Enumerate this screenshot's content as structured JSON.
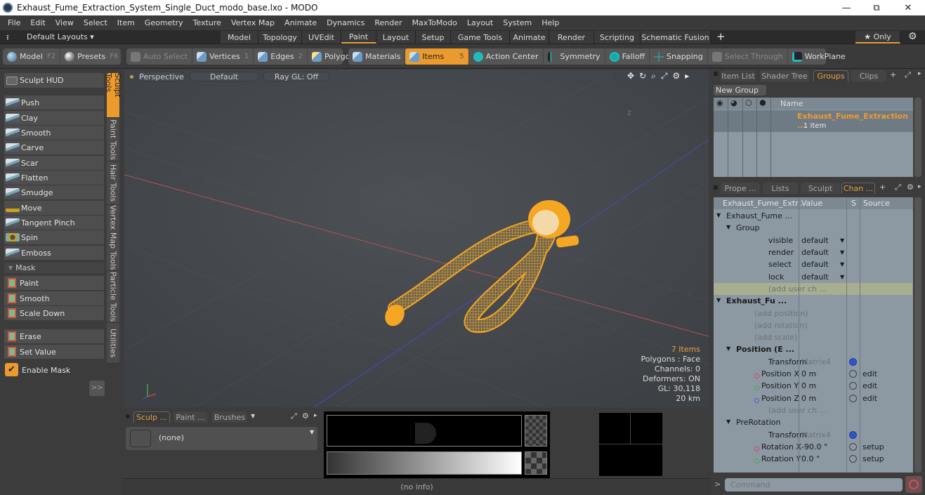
{
  "window": {
    "title": "Exhaust_Fume_Extraction_System_Single_Duct_modo_base.lxo - MODO",
    "minimize": "—",
    "restore": "⧉",
    "close": "✕"
  },
  "menu": [
    "File",
    "Edit",
    "View",
    "Select",
    "Item",
    "Geometry",
    "Texture",
    "Vertex Map",
    "Animate",
    "Dynamics",
    "Render",
    "MaxToModo",
    "Layout",
    "System",
    "Help"
  ],
  "layouts": {
    "dropdown": "Default Layouts ▾",
    "tabs": [
      "Model",
      "Topology",
      "UVEdit",
      "Paint",
      "Layout",
      "Setup",
      "Game Tools",
      "Animate",
      "Render",
      "Scripting",
      "Schematic Fusion"
    ],
    "active_tab": "Paint",
    "add": "+",
    "only": "★ Only"
  },
  "toolbar": {
    "model": "Model",
    "model_key": "F2",
    "presets": "Presets",
    "presets_key": "F6",
    "auto_select": "Auto Select",
    "vertices": "Vertices",
    "vertices_key": "1",
    "edges": "Edges",
    "edges_key": "2",
    "polygons": "Polygons",
    "materials": "Materials",
    "items": "Items",
    "items_key": "5",
    "action_center": "Action Center",
    "symmetry": "Symmetry",
    "falloff": "Falloff",
    "snapping": "Snapping",
    "select_through": "Select Through",
    "workplane": "WorkPlane"
  },
  "left": {
    "sculpt_hud": "Sculpt HUD",
    "tools": [
      "Push",
      "Clay",
      "Smooth",
      "Carve",
      "Scar",
      "Flatten",
      "Smudge",
      "Move",
      "Tangent Pinch",
      "Spin",
      "Emboss"
    ],
    "mask_header": "Mask",
    "mask_tools": [
      "Paint",
      "Smooth",
      "Scale Down"
    ],
    "mask_tools2": [
      "Erase",
      "Set Value"
    ],
    "enable_mask": "Enable Mask",
    "enable_mask_checked": true,
    "expand": ">>",
    "vtabs": [
      "Sculpt Tools",
      "Paint Tools",
      "Hair Tools",
      "Vertex Map Tools",
      "Particle Tools",
      "Utilities"
    ]
  },
  "viewport": {
    "view": "Perspective",
    "style": "Default",
    "raygl": "Ray GL: Off",
    "axis_label": "Z",
    "stats": {
      "items": "7 Items",
      "polygons": "Polygons : Face",
      "channels": "Channels: 0",
      "deformers": "Deformers: ON",
      "gl": "GL: 30,118",
      "scale": "20 km"
    }
  },
  "groups_panel": {
    "tabs": [
      "Item List",
      "Shader Tree",
      "Groups",
      "Clips"
    ],
    "active_tab": "Groups",
    "new_group": "New Group",
    "col_name": "Name",
    "group_name": "Exhaust_Fume_Extraction ...",
    "group_count": "1 Item"
  },
  "channels_panel": {
    "tabs": [
      "Prope ...",
      "Lists",
      "Sculpt",
      "Chan ..."
    ],
    "active_tab": "Chan ...",
    "headers": [
      "Exhaust_Fume_Extr...",
      "Value",
      "S",
      "Source"
    ],
    "rows": [
      {
        "name": "Exhaust_Fume ...",
        "indent": 1,
        "type": "item"
      },
      {
        "name": "Group",
        "indent": 2,
        "type": "group"
      },
      {
        "name": "visible",
        "value": "default",
        "dropdown": true,
        "indent": 3
      },
      {
        "name": "render",
        "value": "default",
        "dropdown": true,
        "indent": 3
      },
      {
        "name": "select",
        "value": "default",
        "dropdown": true,
        "indent": 3
      },
      {
        "name": "lock",
        "value": "default",
        "dropdown": true,
        "indent": 3
      },
      {
        "name": "(add user ch ...",
        "indent": 3,
        "gray": true,
        "highlight": true
      },
      {
        "name": "Exhaust_Fu  ...",
        "indent": 1,
        "bold": true,
        "type": "locator"
      },
      {
        "name": "(add position)",
        "indent": 2,
        "gray": true
      },
      {
        "name": "(add rotation)",
        "indent": 2,
        "gray": true
      },
      {
        "name": "(add scale)",
        "indent": 2,
        "gray": true
      },
      {
        "name": "Position (E ...",
        "indent": 2,
        "bold": true,
        "type": "xform"
      },
      {
        "name": "Transform",
        "value": "Matrix4",
        "value_gray": true,
        "gear": true,
        "indent": 3
      },
      {
        "name": "Position X",
        "value": "0 m",
        "state": true,
        "source": "edit",
        "dot": "#d9455f",
        "indent": 3
      },
      {
        "name": "Position Y",
        "value": "0 m",
        "state": true,
        "source": "edit",
        "dot": "#3fae5a",
        "indent": 3
      },
      {
        "name": "Position Z",
        "value": "0 m",
        "state": true,
        "source": "edit",
        "dot": "#4a5fd0",
        "indent": 3
      },
      {
        "name": "(add user ch ...",
        "indent": 3,
        "gray": true
      },
      {
        "name": "PreRotation",
        "indent": 2,
        "type": "rot"
      },
      {
        "name": "Transform",
        "value": "Matrix4",
        "value_gray": true,
        "gear": true,
        "indent": 3
      },
      {
        "name": "Rotation X",
        "value": "-90.0 °",
        "state": true,
        "source": "setup",
        "dot": "#d9455f",
        "indent": 3
      },
      {
        "name": "Rotation Y",
        "value": "0.0 °",
        "state": true,
        "source": "setup",
        "dot": "#3fae5a",
        "indent": 3
      }
    ],
    "command_placeholder": "Command"
  },
  "bottom": {
    "tabs": [
      "Sculp ...",
      "Paint ...",
      "Brushes"
    ],
    "active_tab": "Sculp ...",
    "brush_value": "(none)",
    "status": "(no info)"
  },
  "colors": {
    "accent": "#eb9a2e",
    "selection": "#f5a623",
    "x_axis": "#c0504d",
    "z_axis": "#3d4fc0"
  }
}
